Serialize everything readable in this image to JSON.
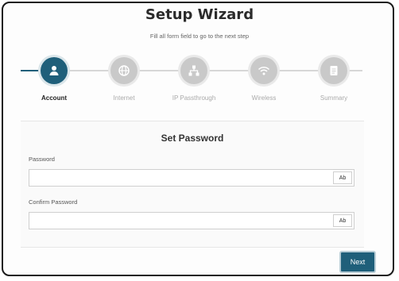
{
  "header": {
    "title": "Setup Wizard",
    "subtitle": "Fill all form field to go to the next step"
  },
  "steps": [
    {
      "label": "Account",
      "icon": "user-icon",
      "active": true
    },
    {
      "label": "Internet",
      "icon": "globe-icon",
      "active": false
    },
    {
      "label": "IP Passthrough",
      "icon": "network-icon",
      "active": false
    },
    {
      "label": "Wireless",
      "icon": "wifi-icon",
      "active": false
    },
    {
      "label": "Summary",
      "icon": "document-icon",
      "active": false
    }
  ],
  "form": {
    "title": "Set Password",
    "password_label": "Password",
    "password_value": "",
    "confirm_label": "Confirm Password",
    "confirm_value": "",
    "toggle_label": "Ab"
  },
  "footer": {
    "next_label": "Next"
  },
  "colors": {
    "accent": "#1f5f7a",
    "inactive_step": "#c9c9c9"
  }
}
